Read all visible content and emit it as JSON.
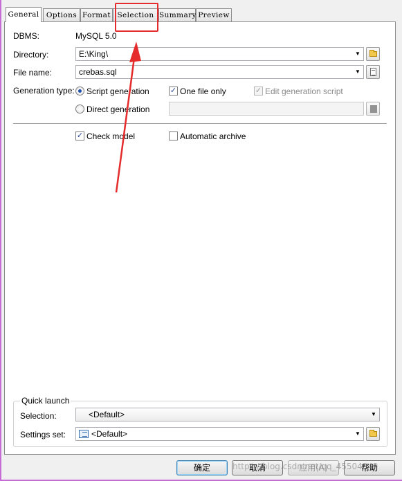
{
  "tabs": [
    {
      "label": "General"
    },
    {
      "label": "Options"
    },
    {
      "label": "Format"
    },
    {
      "label": "Selection"
    },
    {
      "label": "Summary"
    },
    {
      "label": "Preview"
    }
  ],
  "general": {
    "dbms_label": "DBMS:",
    "dbms_value": "MySQL 5.0",
    "directory_label": "Directory:",
    "directory_value": "E:\\King\\",
    "filename_label": "File name:",
    "filename_value": "crebas.sql",
    "gentype_label": "Generation type:",
    "script_generation": "Script generation",
    "direct_generation": "Direct generation",
    "one_file_only": "One file only",
    "edit_generation_script": "Edit generation script",
    "check_model": "Check model",
    "automatic_archive": "Automatic archive"
  },
  "quick_launch": {
    "title": "Quick launch",
    "selection_label": "Selection:",
    "selection_value": "<Default>",
    "settings_label": "Settings set:",
    "settings_value": "<Default>"
  },
  "buttons": {
    "ok": "确定",
    "cancel": "取消",
    "apply": "应用(A)",
    "help": "帮助"
  },
  "watermark": "https://blog.csdn.net/qq_45504942",
  "colors": {
    "annotation": "#e52b2b",
    "window_border": "#c76bd6"
  },
  "icons": [
    "folder-icon",
    "document-icon",
    "list-icon",
    "dropdown-arrow-icon",
    "red-arrow-annotation"
  ]
}
